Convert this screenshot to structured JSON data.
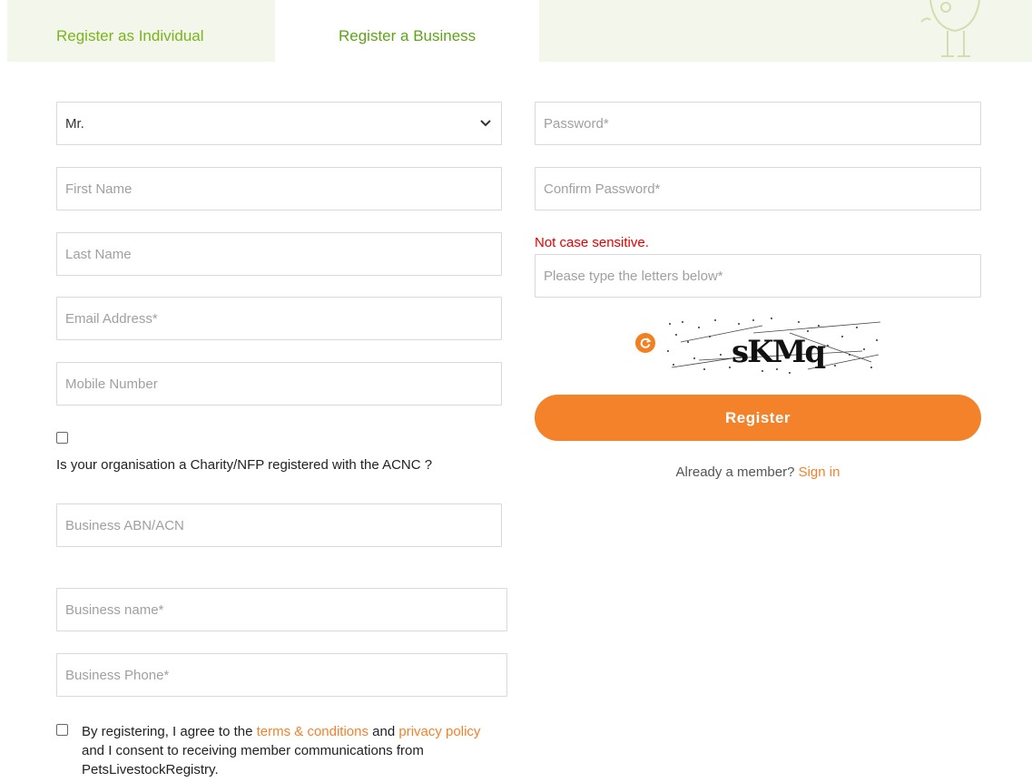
{
  "tabs": {
    "individual": "Register as Individual",
    "business": "Register a Business"
  },
  "form": {
    "title_select": {
      "value": "Mr."
    },
    "first_name": {
      "placeholder": "First Name"
    },
    "last_name": {
      "placeholder": "Last Name"
    },
    "email": {
      "placeholder": "Email Address*"
    },
    "mobile": {
      "placeholder": "Mobile Number"
    },
    "charity_question": "Is your organisation a Charity/NFP registered with the ACNC ?",
    "abn": {
      "placeholder": "Business ABN/ACN"
    },
    "business_name": {
      "placeholder": "Business name*"
    },
    "business_phone": {
      "placeholder": "Business Phone*"
    },
    "password": {
      "placeholder": "Password*"
    },
    "confirm_password": {
      "placeholder": "Confirm Password*"
    },
    "captcha_note": "Not case sensitive.",
    "captcha_input": {
      "placeholder": "Please type the letters below*"
    },
    "captcha_text": "sKMq",
    "register_label": "Register",
    "member_text": "Already a member?",
    "sign_in_label": "Sign in"
  },
  "terms": {
    "prefix": "By registering, I agree to the",
    "terms_link": "terms & conditions",
    "and": "and",
    "privacy_link": "privacy policy",
    "suffix": "and I consent to receiving member communications from PetsLivestockRegistry."
  },
  "colors": {
    "accent": "#f4822a",
    "tab_green": "#7ab51d",
    "tab_bg": "#f3f6ea",
    "error": "#e50000"
  }
}
